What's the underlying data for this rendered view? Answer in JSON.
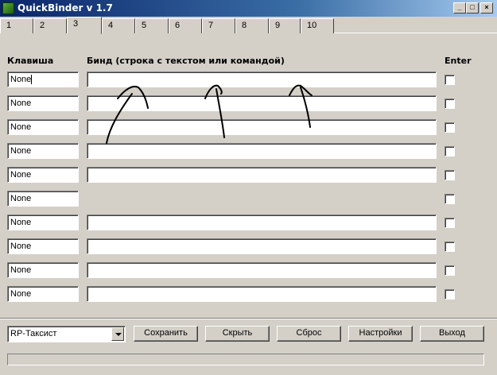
{
  "window": {
    "title": "QuickBinder v 1.7"
  },
  "tabs": [
    {
      "label": "1",
      "active": false
    },
    {
      "label": "2",
      "active": false
    },
    {
      "label": "3",
      "active": true
    },
    {
      "label": "4",
      "active": false
    },
    {
      "label": "5",
      "active": false
    },
    {
      "label": "6",
      "active": false
    },
    {
      "label": "7",
      "active": false
    },
    {
      "label": "8",
      "active": false
    },
    {
      "label": "9",
      "active": false
    },
    {
      "label": "10",
      "active": false
    }
  ],
  "headers": {
    "key": "Клавиша",
    "bind": "Бинд (строка с текстом или командой)",
    "enter": "Enter"
  },
  "rows": [
    {
      "key": "None",
      "bind": "",
      "has_bind": true,
      "enter": false
    },
    {
      "key": "None",
      "bind": "",
      "has_bind": true,
      "enter": false
    },
    {
      "key": "None",
      "bind": "",
      "has_bind": true,
      "enter": false
    },
    {
      "key": "None",
      "bind": "",
      "has_bind": true,
      "enter": false
    },
    {
      "key": "None",
      "bind": "",
      "has_bind": true,
      "enter": false
    },
    {
      "key": "None",
      "bind": "",
      "has_bind": false,
      "enter": false
    },
    {
      "key": "None",
      "bind": "",
      "has_bind": true,
      "enter": false
    },
    {
      "key": "None",
      "bind": "",
      "has_bind": true,
      "enter": false
    },
    {
      "key": "None",
      "bind": "",
      "has_bind": true,
      "enter": false
    },
    {
      "key": "None",
      "bind": "",
      "has_bind": true,
      "enter": false
    }
  ],
  "footer": {
    "profile": {
      "selected": "RP-Таксист"
    },
    "buttons": {
      "save": "Сохранить",
      "hide": "Скрыть",
      "reset": "Сброс",
      "settings": "Настройки",
      "exit": "Выход"
    },
    "progress": 0
  }
}
